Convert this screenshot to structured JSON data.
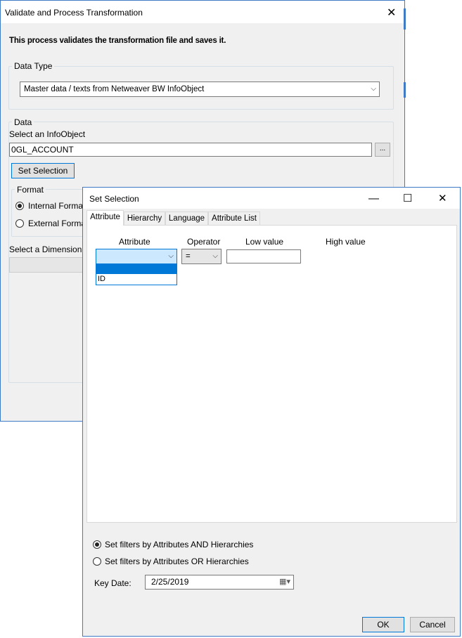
{
  "main_window": {
    "title": "Validate and Process Transformation",
    "description": "This process validates the transformation file and saves it.",
    "data_type": {
      "label": "Data Type",
      "selected": "Master data / texts from Netweaver BW InfoObject"
    },
    "data_group": {
      "label": "Data",
      "infoobject_label": "Select an InfoObject",
      "infoobject_value": "0GL_ACCOUNT",
      "browse_label": "...",
      "set_selection_label": "Set Selection"
    },
    "format": {
      "label": "Format",
      "internal_label": "Internal Format",
      "external_label": "External Format"
    },
    "dimension_label": "Select a Dimension"
  },
  "dialog": {
    "title": "Set Selection",
    "controls": {
      "minimize": "—",
      "maximize": "☐",
      "close": "✕"
    },
    "tabs": [
      {
        "label": "Attribute"
      },
      {
        "label": "Hierarchy"
      },
      {
        "label": "Language"
      },
      {
        "label": "Attribute List"
      }
    ],
    "columns": {
      "attribute": "Attribute",
      "operator": "Operator",
      "low": "Low value",
      "high": "High value"
    },
    "operator_value": "=",
    "attribute_options": [
      "",
      "ID"
    ],
    "filter_options": {
      "and_label": "Set filters by Attributes AND Hierarchies",
      "or_label": "Set filters by Attributes OR Hierarchies"
    },
    "key_date": {
      "label": "Key Date:",
      "value": "2/25/2019"
    },
    "ok_label": "OK",
    "cancel_label": "Cancel"
  }
}
